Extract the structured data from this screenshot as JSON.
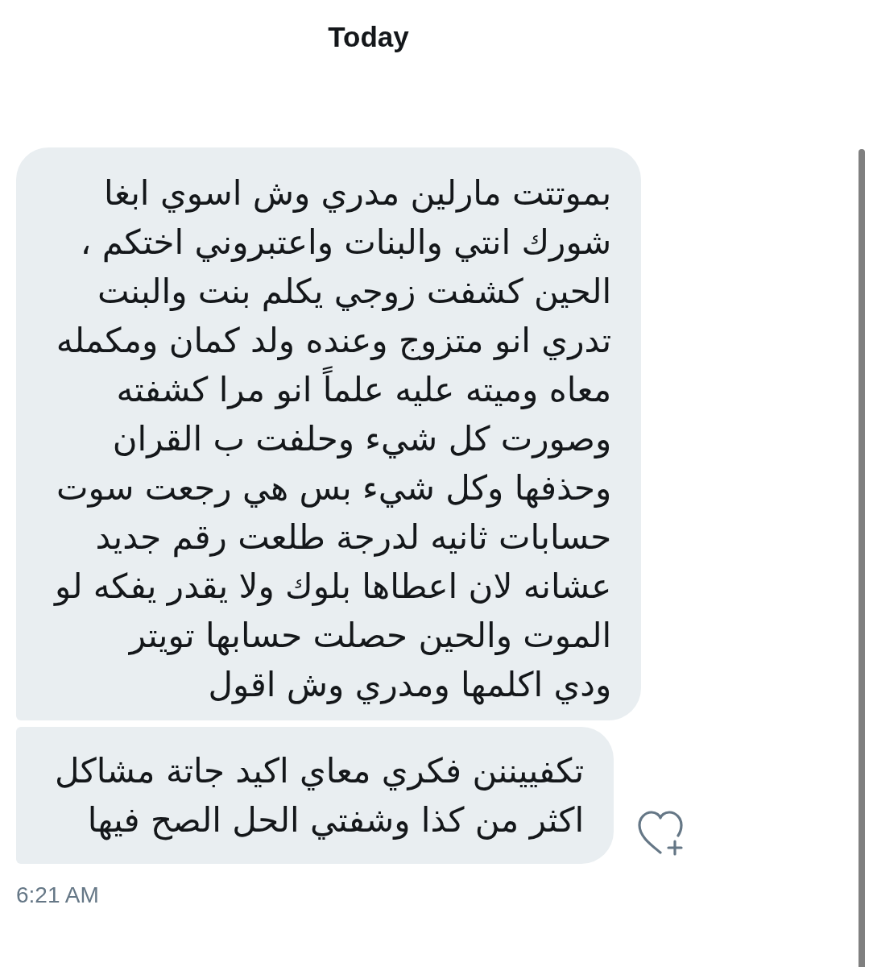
{
  "header": {
    "title": "Today"
  },
  "messages": [
    {
      "lines": [
        "بموتتت مارلين مدري وش اسوي ابغا",
        "شورك انتي والبنات واعتبروني اختكم ،",
        "الحين كشفت زوجي يكلم بنت والبنت",
        "تدري انو متزوج وعنده ولد كمان ومكمله",
        "معاه وميته عليه علماً انو مرا كشفته",
        "وصورت كل شيء وحلفت ب القران",
        "وحذفها وكل شيء بس هي رجعت سوت",
        "حسابات ثانيه لدرجة طلعت رقم جديد",
        "عشانه لان اعطاها بلوك ولا يقدر يفكه لو",
        "الموت والحين حصلت حسابها تويتر",
        "ودي اكلمها ومدري وش اقول"
      ]
    },
    {
      "lines": [
        "تكفييننن فكري معاي اكيد جاتة مشاكل",
        "اكثر من كذا وشفتي الحل الصح فيها"
      ]
    }
  ],
  "timestamp": "6:21 AM"
}
